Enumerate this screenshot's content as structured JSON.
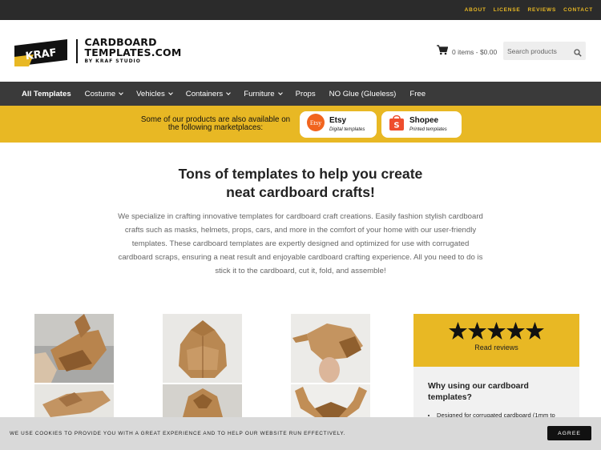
{
  "topbar": {
    "links": [
      "ABOUT",
      "LICENSE",
      "REVIEWS",
      "CONTACT"
    ]
  },
  "header": {
    "logo": {
      "badge": "KRAF",
      "line1": "CARDBOARD",
      "line2": "TEMPLATES.COM",
      "line3": "BY KRAF STUDIO"
    },
    "cart": {
      "label": "0 items - $0.00",
      "icon": "cart-icon"
    },
    "search": {
      "placeholder": "Search products",
      "icon": "search-icon"
    }
  },
  "nav": {
    "items": [
      {
        "label": "All Templates",
        "dropdown": false,
        "active": true
      },
      {
        "label": "Costume",
        "dropdown": true
      },
      {
        "label": "Vehicles",
        "dropdown": true
      },
      {
        "label": "Containers",
        "dropdown": true
      },
      {
        "label": "Furniture",
        "dropdown": true
      },
      {
        "label": "Props",
        "dropdown": false
      },
      {
        "label": "NO Glue (Glueless)",
        "dropdown": false
      },
      {
        "label": "Free",
        "dropdown": false
      }
    ]
  },
  "marketplace": {
    "text": "Some of our products are also available on the following marketplaces:",
    "etsy": {
      "name": "Etsy",
      "sub": "Digital templates",
      "icon_text": "Etsy",
      "color": "#f1641e"
    },
    "shopee": {
      "name": "Shopee",
      "sub": "Printed templates",
      "icon_text": "S",
      "color": "#ee4d2d"
    }
  },
  "hero": {
    "title_line1": "Tons of templates to help you create",
    "title_line2": "neat cardboard crafts!",
    "description": "We specialize in crafting innovative templates for cardboard craft creations. Easily fashion stylish cardboard crafts such as masks, helmets, props, cars, and more in the comfort of your home with our user-friendly templates. These cardboard templates are expertly designed and optimized for use with corrugated cardboard scraps, ensuring a neat result and enjoyable cardboard crafting experience. All you need to do is stick it to the cardboard, cut it, fold, and assemble!"
  },
  "products": [
    {
      "name": "cardboard-dragon-head-photo"
    },
    {
      "name": "cardboard-crown-helmet-photo"
    },
    {
      "name": "cardboard-creature-head-photo"
    }
  ],
  "reviews": {
    "stars": 5,
    "label": "Read reviews"
  },
  "why": {
    "title": "Why using our cardboard templates?",
    "bullets": [
      "Designed for corrugated cardboard (1mm to"
    ]
  },
  "cookie": {
    "text": "WE USE COOKIES TO PROVIDE YOU WITH A GREAT EXPERIENCE AND TO HELP OUR WEBSITE RUN EFFECTIVELY.",
    "button": "AGREE"
  },
  "colors": {
    "accent": "#e8b824",
    "dark": "#2b2b2b",
    "nav": "#3a3a3a"
  }
}
